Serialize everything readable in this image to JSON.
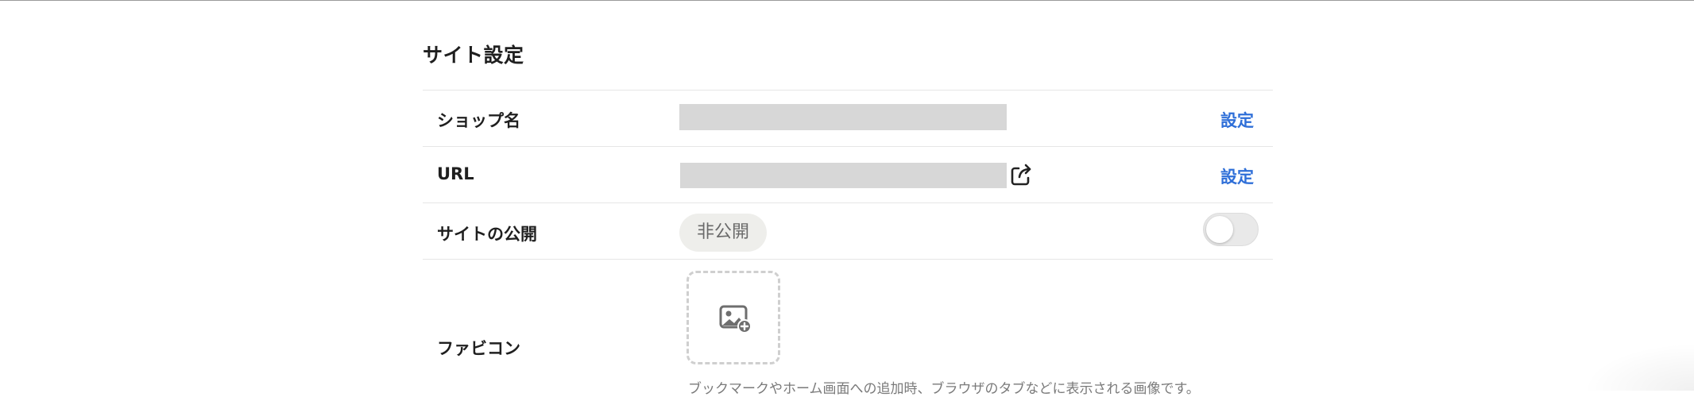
{
  "section": {
    "title": "サイト設定"
  },
  "rows": {
    "shop_name": {
      "label": "ショップ名",
      "action": "設定"
    },
    "url": {
      "label": "URL",
      "action": "設定"
    },
    "publish": {
      "label": "サイトの公開",
      "status": "非公開",
      "toggle_on": false
    },
    "favicon": {
      "label": "ファビコン",
      "help": "ブックマークやホーム画面への追加時、ブラウザのタブなどに表示される画像です。"
    }
  },
  "icons": {
    "external": "external-link-icon",
    "image_add": "image-add-icon"
  },
  "colors": {
    "link": "#2f6fd8",
    "redacted": "#d7d7d7",
    "pill_bg": "#eeeeeb"
  }
}
